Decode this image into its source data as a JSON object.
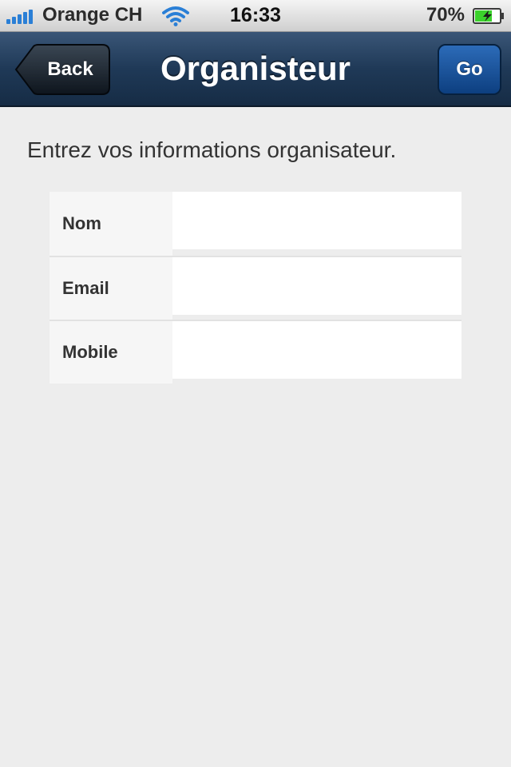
{
  "status_bar": {
    "carrier": "Orange CH",
    "time": "16:33",
    "battery_percent": "70%",
    "battery_level": 0.7,
    "icons": [
      "signal-icon",
      "wifi-icon",
      "battery-charging-icon"
    ]
  },
  "nav": {
    "title": "Organisteur",
    "back_label": "Back",
    "go_label": "Go"
  },
  "form": {
    "intro": "Entrez vos informations organisateur.",
    "fields": [
      {
        "label": "Nom",
        "value": ""
      },
      {
        "label": "Email",
        "value": ""
      },
      {
        "label": "Mobile",
        "value": ""
      }
    ]
  },
  "colors": {
    "nav_bar": "#1f3957",
    "go_button": "#0d3f80",
    "background": "#ededed",
    "signal": "#2a7fd6",
    "battery_fill": "#3bd12c"
  }
}
